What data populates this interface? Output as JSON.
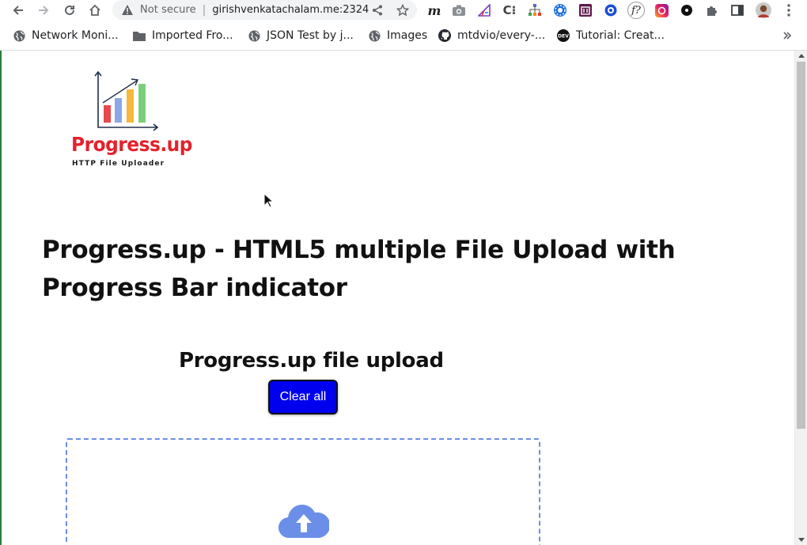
{
  "browser": {
    "security_label": "Not secure",
    "url": "girishvenkatachalam.me:2324",
    "extensions": [
      {
        "icon": "m-icon",
        "glyph": "m"
      },
      {
        "icon": "camera-icon"
      },
      {
        "icon": "ruler-icon"
      },
      {
        "icon": "c-icon",
        "glyph": "C⁝"
      },
      {
        "icon": "sitemap-icon"
      },
      {
        "icon": "gear-blue-icon"
      },
      {
        "icon": "calendar-icon"
      },
      {
        "icon": "ring-icon"
      },
      {
        "icon": "f-icon",
        "glyph": "f?"
      },
      {
        "icon": "instagram-icon"
      },
      {
        "icon": "dot-icon"
      },
      {
        "icon": "puzzle-icon"
      },
      {
        "icon": "sidepanel-icon"
      },
      {
        "icon": "avatar-icon"
      },
      {
        "icon": "menu-icon"
      }
    ]
  },
  "bookmarks": [
    {
      "label": "Network Moni...",
      "icon": "globe-icon"
    },
    {
      "label": "Imported Fro...",
      "icon": "folder-icon"
    },
    {
      "label": "JSON Test by j...",
      "icon": "globe-icon"
    },
    {
      "label": "Images",
      "icon": "globe-icon"
    },
    {
      "label": "mtdvio/every-...",
      "icon": "github-icon"
    },
    {
      "label": "Tutorial: Creat...",
      "icon": "tutorial-icon"
    }
  ],
  "page": {
    "logo": {
      "title": "Progress.up",
      "subtitle": "HTTP File Uploader"
    },
    "title": "Progress.up - HTML5 multiple File Upload with Progress Bar indicator",
    "upload_heading": "Progress.up file upload",
    "clear_button": "Clear all"
  },
  "colors": {
    "accent_button": "#0000ee",
    "dropzone_border": "#6b8ee8",
    "cloud": "#6b8ee8",
    "logo_red": "#e5212b"
  }
}
